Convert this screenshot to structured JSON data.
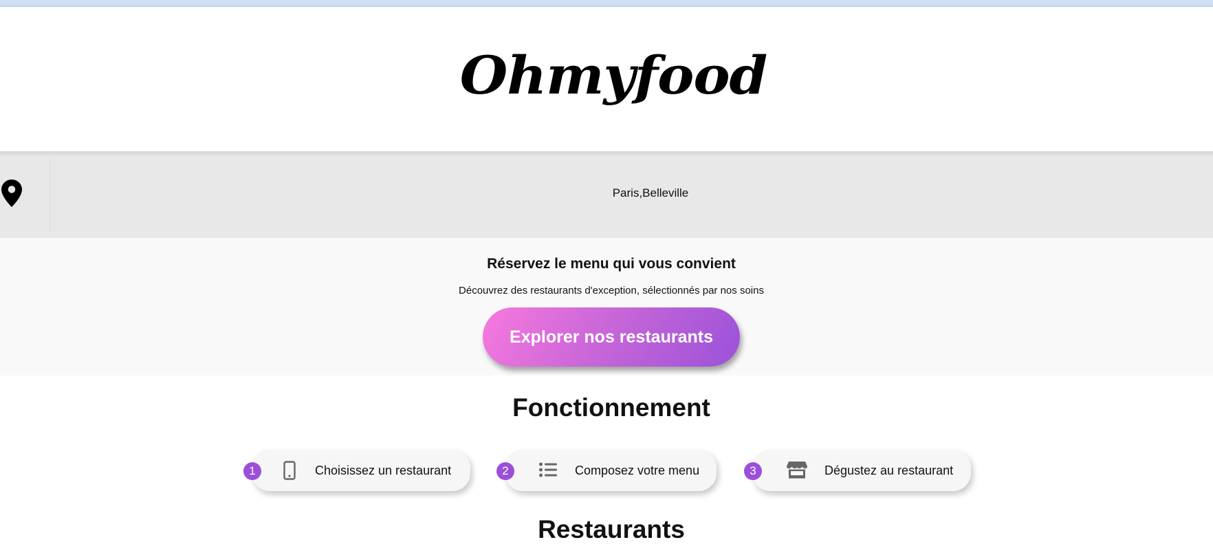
{
  "header": {
    "logo_text": "Ohmyfood"
  },
  "location": {
    "icon": "map-pin-icon",
    "text": "Paris,Belleville"
  },
  "hero": {
    "title": "Réservez le menu qui vous convient",
    "subtitle": "Découvrez des restaurants d'exception, sélectionnés par nos soins",
    "button_label": "Explorer nos restaurants"
  },
  "how_it_works": {
    "title": "Fonctionnement",
    "steps": [
      {
        "number": "1",
        "icon": "mobile-phone-icon",
        "label": "Choisissez un restaurant"
      },
      {
        "number": "2",
        "icon": "list-icon",
        "label": "Composez votre menu"
      },
      {
        "number": "3",
        "icon": "store-icon",
        "label": "Dégustez au restaurant"
      }
    ]
  },
  "restaurants": {
    "title": "Restaurants"
  },
  "colors": {
    "accent_purple": "#9b4fd9",
    "accent_pink": "#f779de",
    "location_bar": "#e8e8e8",
    "hero_background": "#f9f9f9"
  }
}
